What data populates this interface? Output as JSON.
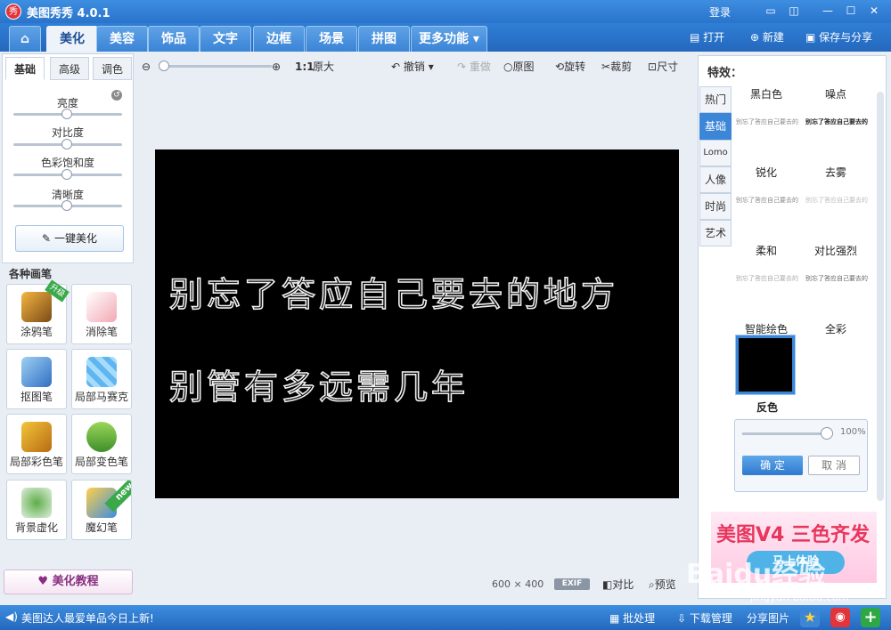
{
  "window": {
    "title": "美图秀秀 4.0.1",
    "logo_text": "秀",
    "login": "登录"
  },
  "nav": {
    "tabs": [
      "美化",
      "美容",
      "饰品",
      "文字",
      "边框",
      "场景",
      "拼图",
      "更多功能"
    ],
    "active_tab": "美化",
    "actions": {
      "open": "打开",
      "new": "新建",
      "save_share": "保存与分享"
    }
  },
  "left": {
    "subtabs": [
      "基础",
      "高级",
      "调色"
    ],
    "sliders": [
      "亮度",
      "对比度",
      "色彩饱和度",
      "清晰度"
    ],
    "oneclick": "一键美化",
    "brush_header": "各种画笔",
    "brushes": [
      "涂鸦笔",
      "消除笔",
      "抠图笔",
      "局部马赛克",
      "局部彩色笔",
      "局部变色笔",
      "背景虚化",
      "魔幻笔"
    ],
    "badges": {
      "upgrade": "升级",
      "new": "new"
    },
    "tutorial": "美化教程"
  },
  "toolbar": {
    "zoom_ratio": "1:1",
    "original_size": "原大",
    "undo": "撤销",
    "redo": "重做",
    "original": "原图",
    "rotate": "旋转",
    "crop": "裁剪",
    "size": "尺寸"
  },
  "canvas": {
    "line1": "别忘了答应自己要去的地方",
    "line2": "别管有多远需几年"
  },
  "bottom": {
    "size": "600 × 400",
    "exif": "EXIF",
    "compare": "对比",
    "preview": "预览"
  },
  "right": {
    "title": "特效：",
    "categories": [
      "热门",
      "基础",
      "Lomo",
      "人像",
      "时尚",
      "艺术"
    ],
    "effects": [
      "黑白色",
      "噪点",
      "锐化",
      "去雾",
      "柔和",
      "对比强烈",
      "智能绘色",
      "全彩"
    ],
    "thumb_text": "别忘了答应自己要去的地方 别管有多远需几年",
    "selected": "反色",
    "opacity": "100%",
    "ok": "确 定",
    "cancel": "取 消",
    "ad_text": "美图V4 三色齐发",
    "ad_button": "马上体验"
  },
  "status": {
    "tip": "美图达人最爱单品今日上新!",
    "batch": "批处理",
    "download": "下载管理",
    "share": "分享图片"
  },
  "watermark": {
    "main": "Baidu经验",
    "sub": "jingyan.baidu.com"
  }
}
